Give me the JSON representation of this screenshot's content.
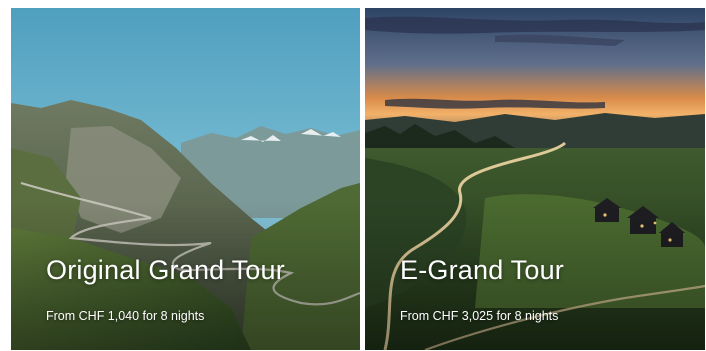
{
  "tours": [
    {
      "title": "Original Grand Tour",
      "subtitle": "From CHF 1,040 for 8 nights",
      "image": "alpine-pass-serpentine-road"
    },
    {
      "title": "E-Grand Tour",
      "subtitle": "From CHF 3,025 for 8 nights",
      "image": "sunset-countryside-road"
    }
  ]
}
